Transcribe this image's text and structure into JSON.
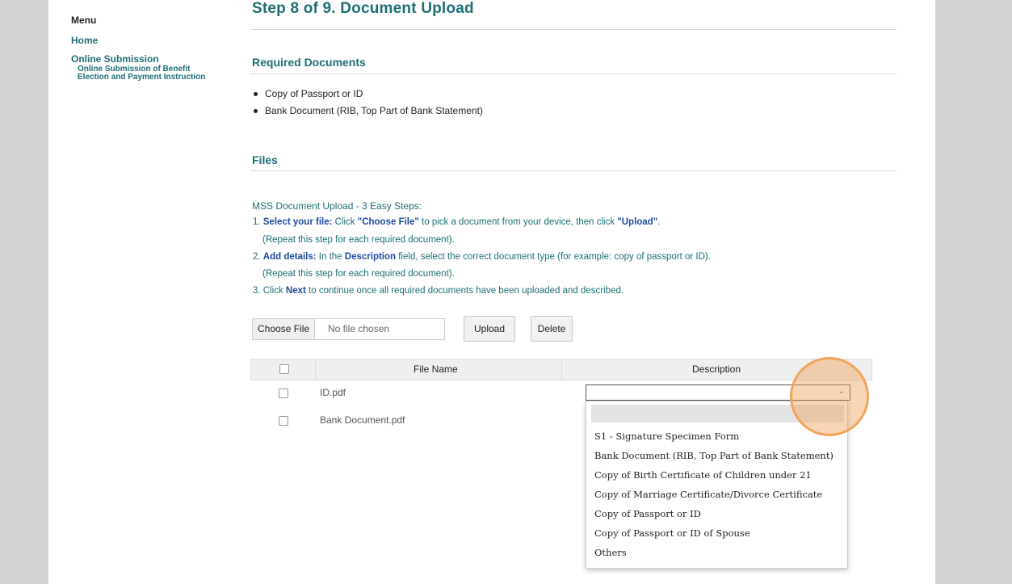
{
  "menu": {
    "title": "Menu",
    "home": "Home",
    "online_submission": "Online Submission",
    "sub_line1": "Online Submission of Benefit",
    "sub_line2": "Election and Payment Instruction"
  },
  "step_title": "Step 8 of 9. Document Upload",
  "required": {
    "heading": "Required Documents",
    "items": [
      "Copy of Passport or ID",
      "Bank Document (RIB, Top Part of Bank Statement)"
    ]
  },
  "files": {
    "heading": "Files",
    "intro": "MSS Document Upload - 3 Easy Steps:",
    "step1_a": "1. ",
    "step1_b": "Select your file:",
    "step1_c": " Click ",
    "step1_d": "\"Choose File\"",
    "step1_e": " to pick a document from your device, then click ",
    "step1_f": "\"Upload\"",
    "step1_g": ".",
    "step1_repeat": "(Repeat this step for each required document).",
    "step2_a": "2. ",
    "step2_b": "Add details:",
    "step2_c": " In the ",
    "step2_d": "Description",
    "step2_e": " field, select the correct document type (for example: copy of passport or ID).",
    "step2_repeat": "(Repeat this step for each required document).",
    "step3_a": "3. Click ",
    "step3_b": "Next",
    "step3_c": " to continue once all required documents have been uploaded and described."
  },
  "upload": {
    "choose_label": "Choose File",
    "no_file": "No file chosen",
    "upload_label": "Upload",
    "delete_label": "Delete"
  },
  "table": {
    "headers": [
      "File Name",
      "Description"
    ],
    "rows": [
      {
        "name": "ID.pdf"
      },
      {
        "name": "Bank Document.pdf"
      }
    ]
  },
  "description_select": {
    "selected": "",
    "options": [
      "",
      "S1 - Signature Specimen Form",
      "Bank Document (RIB, Top Part of Bank Statement)",
      "Copy of Birth Certificate of Children under 21",
      "Copy of Marriage Certificate/Divorce Certificate",
      "Copy of Passport or ID",
      "Copy of Passport or ID of Spouse",
      "Others"
    ]
  },
  "colors": {
    "teal": "#1e6e74",
    "blue_bold": "#1e4aa0",
    "highlight": "#f0a45a"
  }
}
